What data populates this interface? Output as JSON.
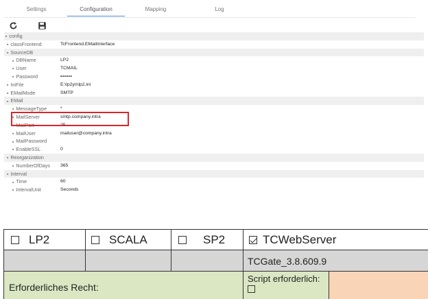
{
  "tabs": [
    "Settings",
    "Configuration",
    "Mapping",
    "Log"
  ],
  "toolbar": {
    "refresh_icon": "refresh-icon",
    "save_icon": "save-icon"
  },
  "tree": [
    {
      "key": "config",
      "value": "",
      "level": 0,
      "alt": true
    },
    {
      "key": "classFrontend",
      "value": "TcFrontend.EMailInterface",
      "level": 1,
      "alt": false
    },
    {
      "key": "SourceDB",
      "value": "",
      "level": 1,
      "alt": true
    },
    {
      "key": "DBName",
      "value": "LP2",
      "level": 2,
      "alt": false
    },
    {
      "key": "User",
      "value": "TCMAIL",
      "level": 2,
      "alt": false
    },
    {
      "key": "Password",
      "value": "••••••",
      "level": 2,
      "alt": false,
      "strong": true
    },
    {
      "key": "IniFile",
      "value": "E:\\lp2yn\\lp2.ini",
      "level": 1,
      "alt": false
    },
    {
      "key": "EMailMode",
      "value": "SMTP",
      "level": 1,
      "alt": false
    },
    {
      "key": "EMail",
      "value": "",
      "level": 1,
      "alt": true
    },
    {
      "key": "MessageType",
      "value": "*",
      "level": 2,
      "alt": false
    },
    {
      "key": "MailServer",
      "value": "smtp.company.intra",
      "level": 2,
      "alt": false
    },
    {
      "key": "MailPort",
      "value": "25",
      "level": 2,
      "alt": false
    },
    {
      "key": "MailUser",
      "value": "mailuser@company.intra",
      "level": 2,
      "alt": false
    },
    {
      "key": "MailPassword",
      "value": "",
      "level": 2,
      "alt": false
    },
    {
      "key": "EnableSSL",
      "value": "0",
      "level": 2,
      "alt": false
    },
    {
      "key": "Reorganization",
      "value": "",
      "level": 1,
      "alt": true
    },
    {
      "key": "NumberOfDays",
      "value": "365",
      "level": 2,
      "alt": false
    },
    {
      "key": "Interval",
      "value": "",
      "level": 1,
      "alt": true
    },
    {
      "key": "Time",
      "value": "60",
      "level": 2,
      "alt": false
    },
    {
      "key": "IntervalUnit",
      "value": "Seconds",
      "level": 2,
      "alt": false
    }
  ],
  "table": {
    "headers": [
      {
        "label": "LP2",
        "checked": false
      },
      {
        "label": "SCALA",
        "checked": false
      },
      {
        "label": "SP2",
        "checked": false
      },
      {
        "label": "TCWebServer",
        "checked": true
      }
    ],
    "version": "TCGate_3.8.609.9",
    "right_label": "Erforderliches Recht:",
    "script_label": "Script erforderlich:",
    "script_checked": false
  },
  "colors": {
    "highlight": "#d9262a",
    "tab_accent": "#4a90d9",
    "green_cell": "#dbe7c3",
    "orange_cell": "#f9d4b6",
    "gray_cell": "#d6d6d6"
  }
}
